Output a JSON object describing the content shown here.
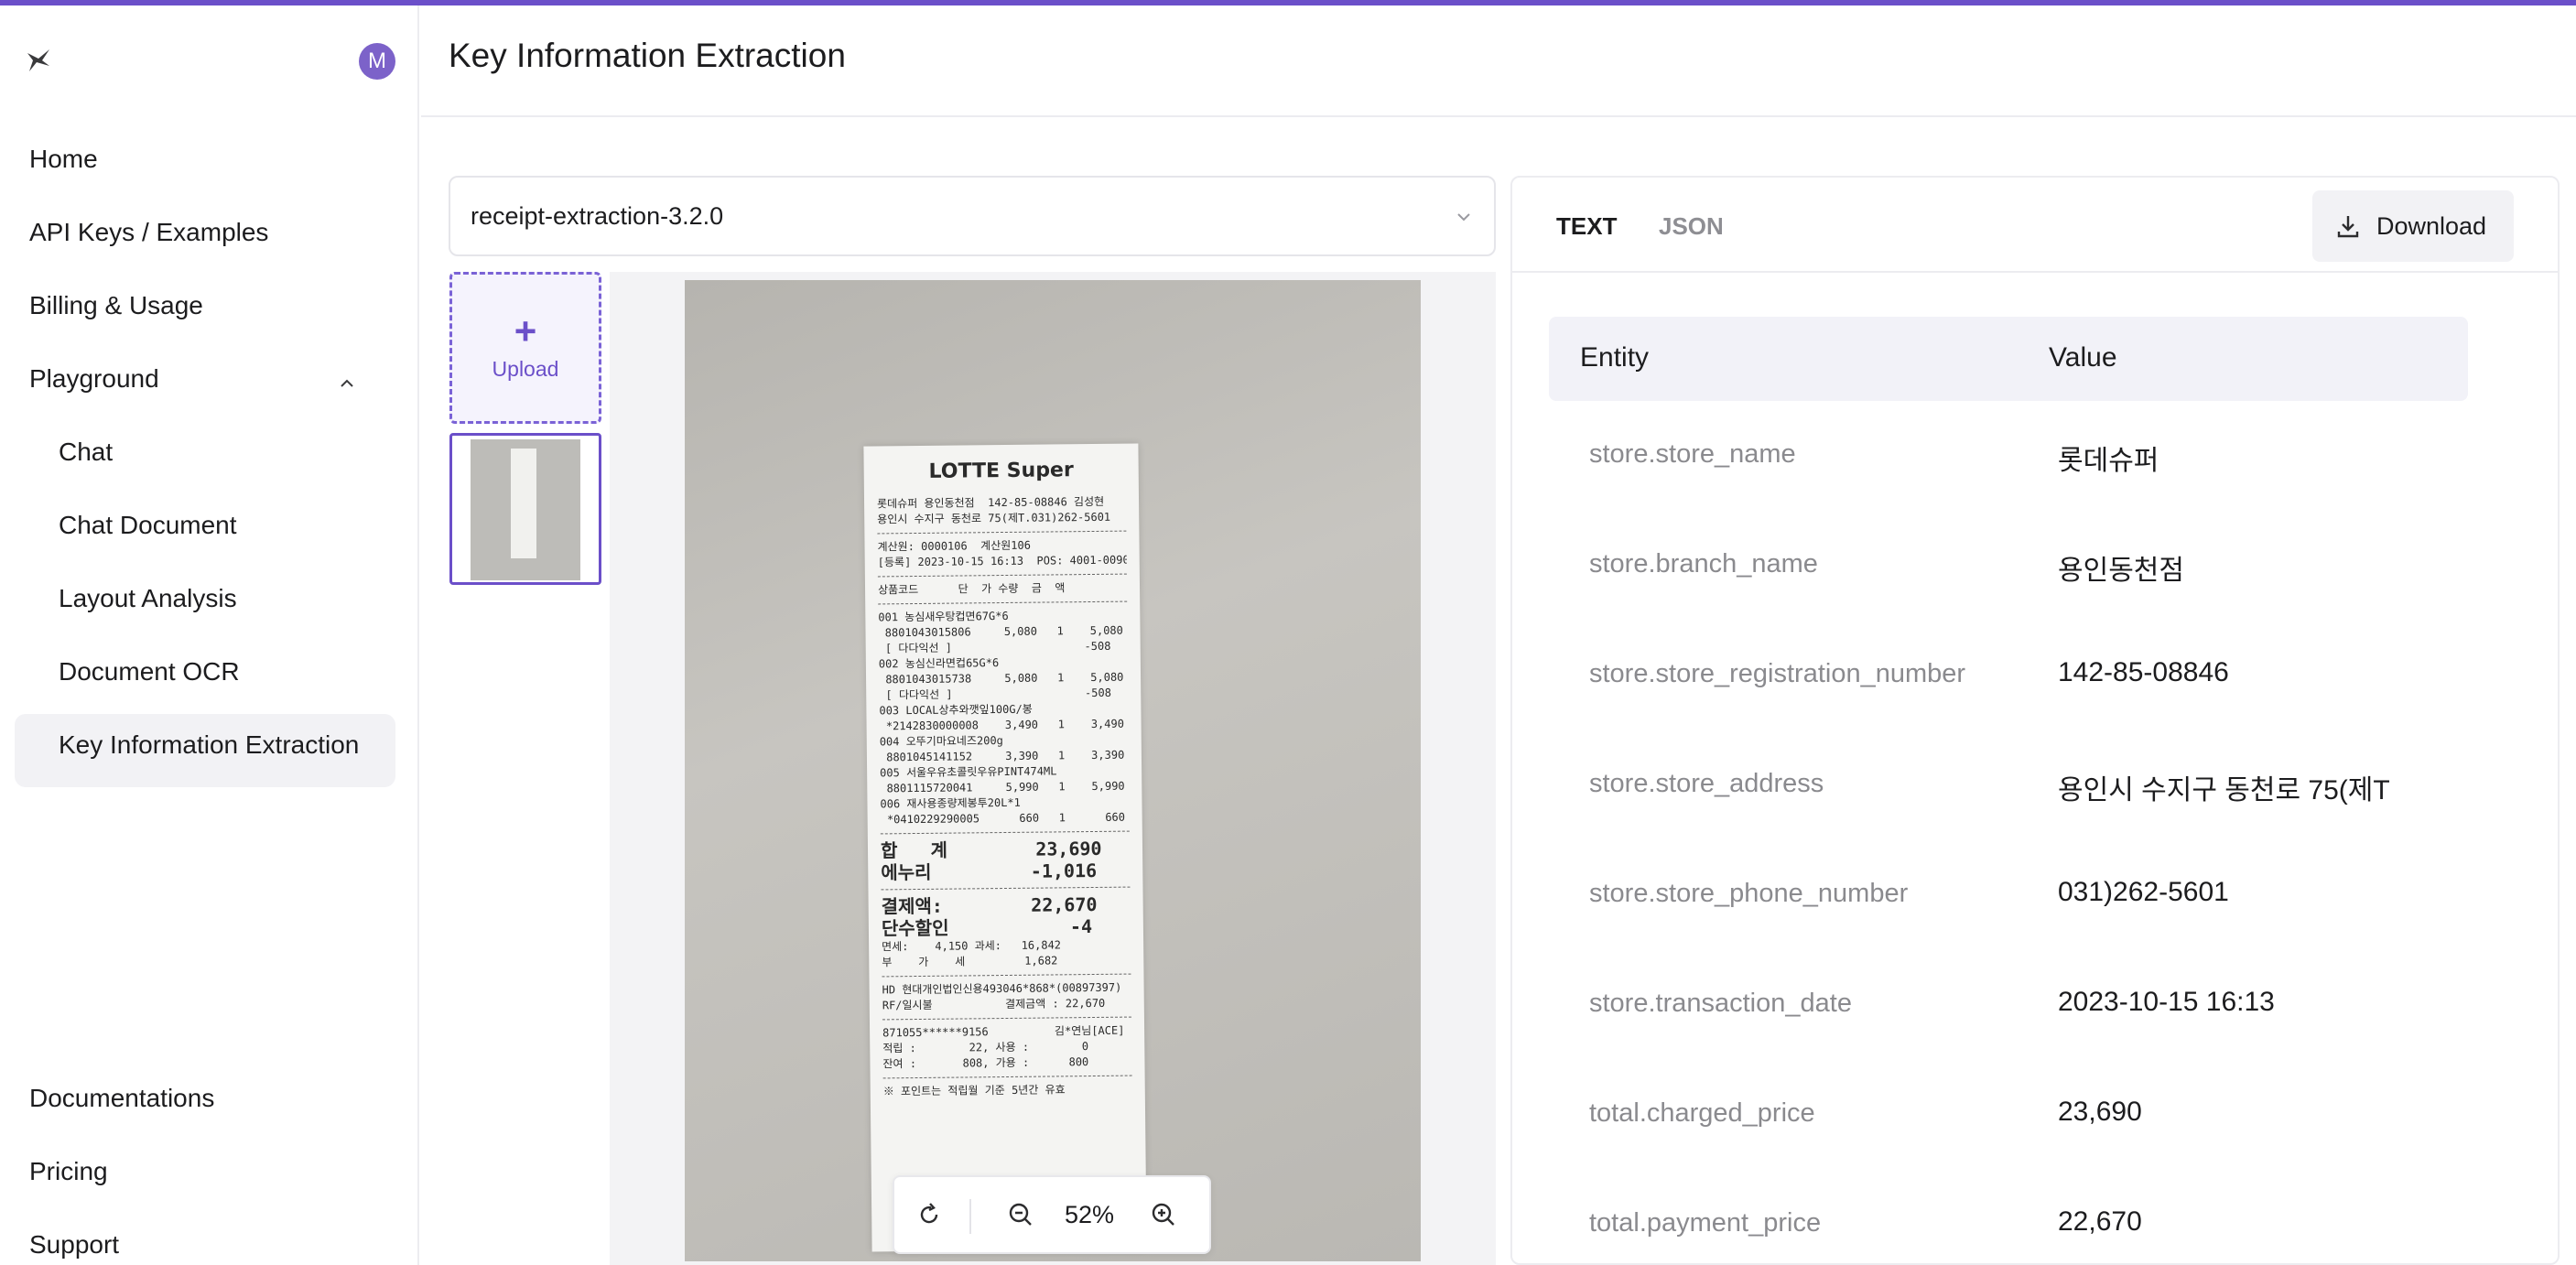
{
  "app": {
    "title": "Key Information Extraction",
    "avatar_initial": "M",
    "accent_color": "#6b4fc9"
  },
  "sidebar": {
    "items": [
      {
        "label": "Home"
      },
      {
        "label": "API Keys / Examples"
      },
      {
        "label": "Billing & Usage"
      },
      {
        "label": "Playground"
      },
      {
        "label": "Chat"
      },
      {
        "label": "Chat Document"
      },
      {
        "label": "Layout Analysis"
      },
      {
        "label": "Document OCR"
      },
      {
        "label": "Key Information Extraction"
      }
    ],
    "footer_items": [
      {
        "label": "Documentations"
      },
      {
        "label": "Pricing"
      },
      {
        "label": "Support"
      }
    ],
    "active_item": "Key Information Extraction"
  },
  "model_select": {
    "value": "receipt-extraction-3.2.0"
  },
  "upload": {
    "label": "Upload"
  },
  "viewer": {
    "zoom": "52%",
    "receipt": {
      "brand": "LOTTE Super",
      "lines_top": [
        "롯데슈퍼 용인동천점  142-85-08846 김성현",
        "용인시 수지구 동천로 75(제T.031)262-5601"
      ],
      "lines_mid": [
        "계산원: 0000106  계산원106",
        "[등록] 2023-10-15 16:13  POS: 4001-0090"
      ],
      "header": "상품코드      단  가 수량  금  액",
      "items": [
        "001 농심새우탕컵면67G*6",
        " 8801043015806     5,080   1    5,080",
        " [ 다다익선 ]                    -508",
        "002 농심신라면컵65G*6",
        " 8801043015738     5,080   1    5,080",
        " [ 다다익선 ]                    -508",
        "003 LOCAL상추와깻잎100G/봉",
        " *2142830000008    3,490   1    3,490",
        "004 오뚜기마요네즈200g",
        " 8801045141152     3,390   1    3,390",
        "005 서울우유초콜릿우유PINT474ML",
        " 8801115720041     5,990   1    5,990",
        "006 재사용종량제봉투20L*1",
        " *0410229290005      660   1      660"
      ],
      "totals": [
        "합   계        23,690",
        "에누리         -1,016"
      ],
      "payment": [
        "결제액:        22,670",
        "단수할인           -4"
      ],
      "tax": [
        "면세:    4,150 과세:   16,842",
        "부    가    세         1,682"
      ],
      "card": [
        "HD 현대개인법인신용493046*868*(00897397)",
        "RF/일시불           결제금액 : 22,670"
      ],
      "points": [
        "871055******9156          김*연님[ACE]",
        "적립 :        22, 사용 :        0",
        "잔여 :       808, 가용 :      800"
      ],
      "note": "※ 포인트는 적립월 기준 5년간 유효"
    }
  },
  "results": {
    "tabs": [
      {
        "label": "TEXT",
        "active": true
      },
      {
        "label": "JSON",
        "active": false
      }
    ],
    "download_label": "Download",
    "columns": {
      "entity": "Entity",
      "value": "Value"
    },
    "rows": [
      {
        "entity": "store.store_name",
        "value": "롯데슈퍼"
      },
      {
        "entity": "store.branch_name",
        "value": "용인동천점"
      },
      {
        "entity": "store.store_registration_number",
        "value": "142-85-08846"
      },
      {
        "entity": "store.store_address",
        "value": "용인시 수지구 동천로 75(제T"
      },
      {
        "entity": "store.store_phone_number",
        "value": "031)262-5601"
      },
      {
        "entity": "store.transaction_date",
        "value": "2023-10-15 16:13"
      },
      {
        "entity": "total.charged_price",
        "value": "23,690"
      },
      {
        "entity": "total.payment_price",
        "value": "22,670"
      }
    ]
  }
}
